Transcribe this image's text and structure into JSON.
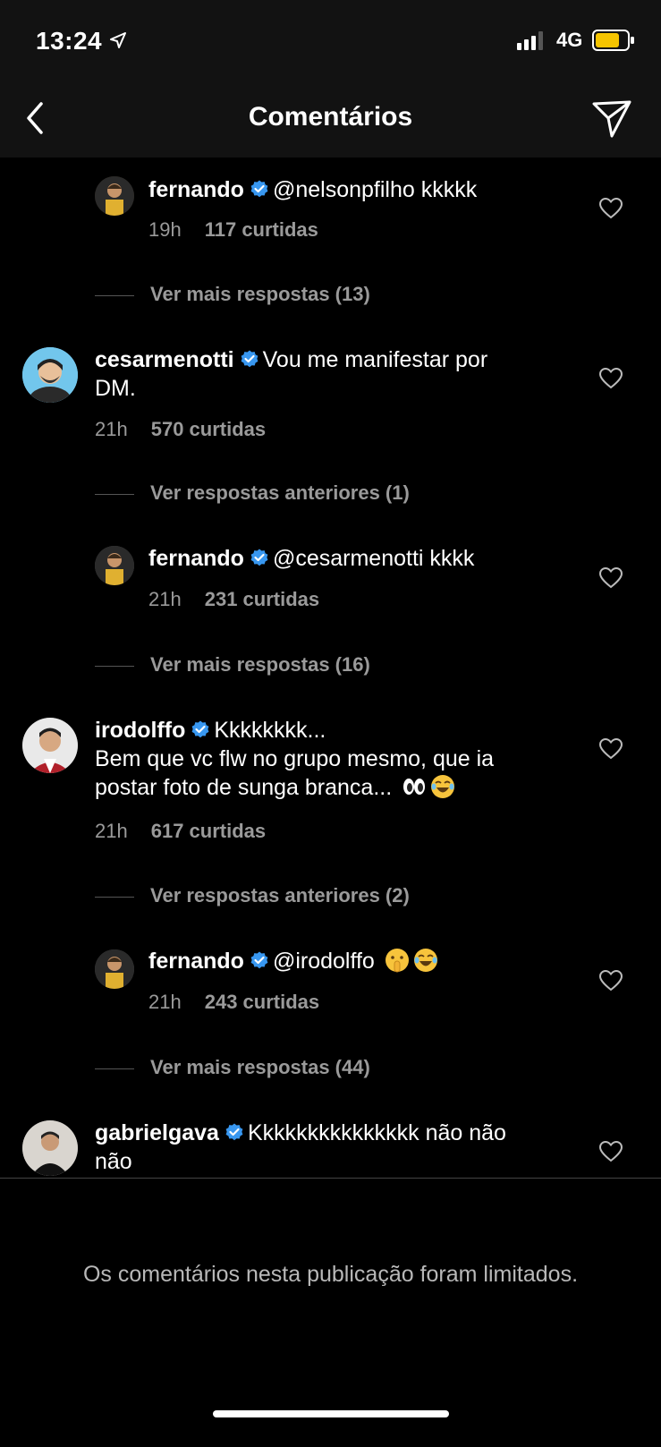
{
  "status": {
    "time": "13:24",
    "network": "4G"
  },
  "header": {
    "title": "Comentários"
  },
  "comments": [
    {
      "user": "fernando",
      "text": "@nelsonpfilho kkkkk",
      "time": "19h",
      "likes": "117 curtidas"
    },
    {
      "user": "cesarmenotti",
      "text_line1": "Vou me manifestar por",
      "text_line2": "DM.",
      "time": "21h",
      "likes": "570 curtidas"
    },
    {
      "user": "fernando",
      "text": "@cesarmenotti kkkk",
      "time": "21h",
      "likes": "231 curtidas"
    },
    {
      "user": "irodolffo",
      "text_line1": "Kkkkkkkk...",
      "text_line2": "Bem que vc flw no grupo mesmo, que ia",
      "text_line3": "postar foto de sunga branca...",
      "time": "21h",
      "likes": "617 curtidas"
    },
    {
      "user": "fernando",
      "text": "@irodolffo",
      "time": "21h",
      "likes": "243 curtidas"
    },
    {
      "user": "gabrielgava",
      "text_line1": "Kkkkkkkkkkkkkkk não não",
      "text_line2": "não"
    }
  ],
  "more_links": [
    "Ver mais respostas (13)",
    "Ver respostas anteriores (1)",
    "Ver mais respostas (16)",
    "Ver respostas anteriores (2)",
    "Ver mais respostas (44)"
  ],
  "footer": {
    "limited_text": "Os comentários nesta publicação foram limitados."
  },
  "icons": [
    "location-arrow-icon",
    "signal-icon",
    "battery-icon",
    "back-chevron-icon",
    "send-icon",
    "verified-icon",
    "heart-icon",
    "eyes-emoji-icon",
    "laughing-emoji-icon",
    "shushing-emoji-icon"
  ],
  "colors": {
    "background": "#000000",
    "bar": "#121212",
    "muted": "#9a9a9a",
    "verified": "#3897f0",
    "battery": "#f5c400"
  }
}
